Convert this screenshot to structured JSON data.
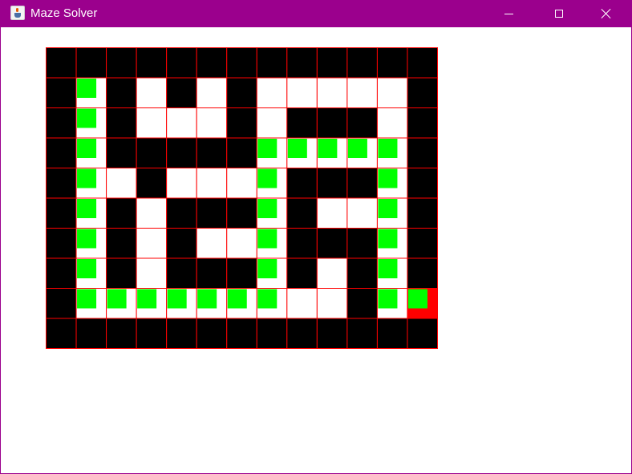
{
  "window": {
    "title": "Maze Solver",
    "titlebar_color": "#9b008d"
  },
  "icons": {
    "app": "java-coffee-cup-icon",
    "minimize": "minimize-icon",
    "maximize": "maximize-icon",
    "close": "close-icon"
  },
  "maze": {
    "rows": 10,
    "cols": 13,
    "legend": {
      "0": "open",
      "1": "wall",
      "2": "path",
      "3": "goal"
    },
    "colors": {
      "wall": "#000000",
      "open": "#ffffff",
      "path": "#00ff00",
      "goal": "#ff0000",
      "grid_line": "#ff0000"
    },
    "grid": [
      [
        1,
        1,
        1,
        1,
        1,
        1,
        1,
        1,
        1,
        1,
        1,
        1,
        1
      ],
      [
        1,
        2,
        1,
        0,
        1,
        0,
        1,
        0,
        0,
        0,
        0,
        0,
        1
      ],
      [
        1,
        2,
        1,
        0,
        0,
        0,
        1,
        0,
        1,
        1,
        1,
        0,
        1
      ],
      [
        1,
        2,
        1,
        1,
        1,
        1,
        1,
        2,
        2,
        2,
        2,
        2,
        1
      ],
      [
        1,
        2,
        0,
        1,
        0,
        0,
        0,
        2,
        1,
        1,
        1,
        2,
        1
      ],
      [
        1,
        2,
        1,
        0,
        1,
        1,
        1,
        2,
        1,
        0,
        0,
        2,
        1
      ],
      [
        1,
        2,
        1,
        0,
        1,
        0,
        0,
        2,
        1,
        1,
        1,
        2,
        1
      ],
      [
        1,
        2,
        1,
        0,
        1,
        1,
        1,
        2,
        1,
        0,
        1,
        2,
        1
      ],
      [
        1,
        2,
        2,
        2,
        2,
        2,
        2,
        2,
        0,
        0,
        1,
        2,
        3
      ],
      [
        1,
        1,
        1,
        1,
        1,
        1,
        1,
        1,
        1,
        1,
        1,
        1,
        1
      ]
    ]
  }
}
